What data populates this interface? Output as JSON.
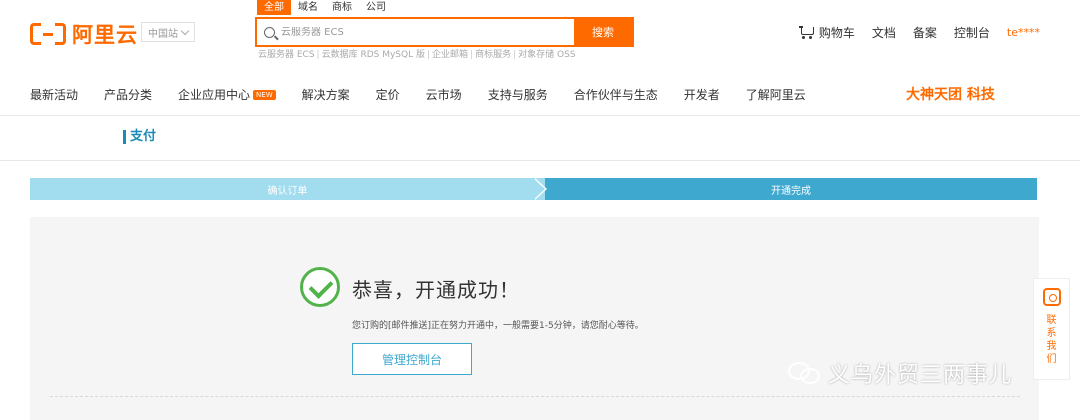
{
  "brand": {
    "name": "阿里云",
    "accent": "#ff6a00"
  },
  "header": {
    "region": "中国站",
    "search_tabs": [
      "全部",
      "域名",
      "商标",
      "公司"
    ],
    "search_placeholder": "云服务器 ECS",
    "search_button": "搜索",
    "hot_words": [
      "云服务器 ECS",
      "云数据库 RDS MySQL 版",
      "企业邮箱",
      "商标服务",
      "对象存储 OSS"
    ],
    "links": {
      "cart": "购物车",
      "docs": "文档",
      "beian": "备案",
      "console": "控制台",
      "user": "te****"
    }
  },
  "nav": {
    "items": [
      "最新活动",
      "产品分类",
      "企业应用中心",
      "解决方案",
      "定价",
      "云市场",
      "支持与服务",
      "合作伙伴与生态",
      "开发者",
      "了解阿里云"
    ],
    "new_badge": "NEW",
    "promo": "大神天团 科技"
  },
  "page": {
    "section_title": "支付"
  },
  "steps": {
    "step1": "确认订单",
    "step2": "开通完成",
    "colors": {
      "done": "#a1dcef",
      "active": "#3fa8cf"
    }
  },
  "result": {
    "title": "恭喜，开通成功！",
    "description": "您订购的[邮件推送]正在努力开通中，一般需要1-5分钟，请您耐心等待。",
    "button": "管理控制台",
    "status_color": "#52b34a"
  },
  "contact": {
    "label": "联系我们"
  },
  "watermark": {
    "text": "义乌外贸三两事儿"
  }
}
